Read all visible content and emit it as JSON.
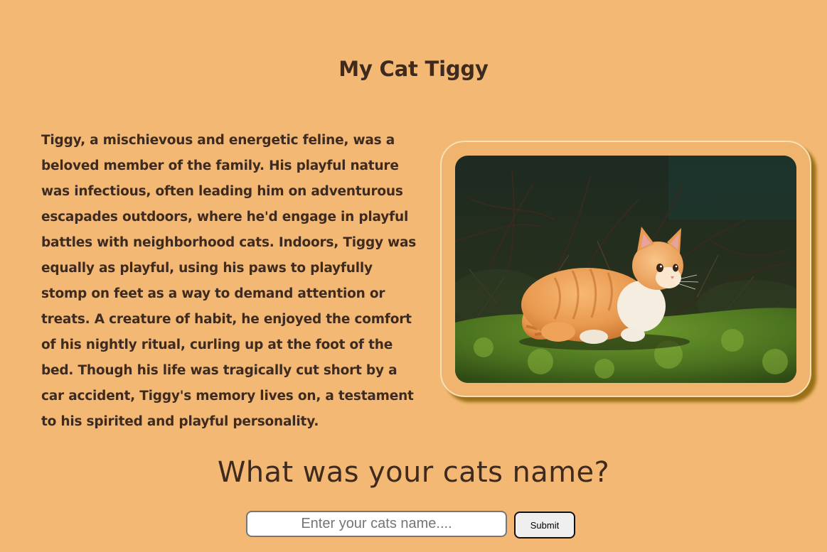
{
  "page": {
    "title": "My Cat Tiggy",
    "background_color": "#f3b974",
    "text_color": "#3f2a1f"
  },
  "story": {
    "text": "Tiggy, a mischievous and energetic feline, was a beloved member of the family. His playful nature was infectious, often leading him on adventurous escapades outdoors, where he'd engage in playful battles with neighborhood cats. Indoors, Tiggy was equally as playful, using his paws to playfully stomp on feet as a way to demand attention or treats. A creature of habit, he enjoyed the comfort of his nightly ritual, curling up at the foot of the bed. Though his life was tragically cut short by a car accident, Tiggy's memory lives on, a testament to his spirited and playful personality."
  },
  "photo": {
    "subject": "orange-tabby-kitten-photo",
    "frame_border_color": "#f6e0b8",
    "shadow_color": "#9a7017"
  },
  "form": {
    "question": "What was your cats name?",
    "input_value": "",
    "input_placeholder": "Enter your cats name....",
    "submit_label": "Submit"
  }
}
